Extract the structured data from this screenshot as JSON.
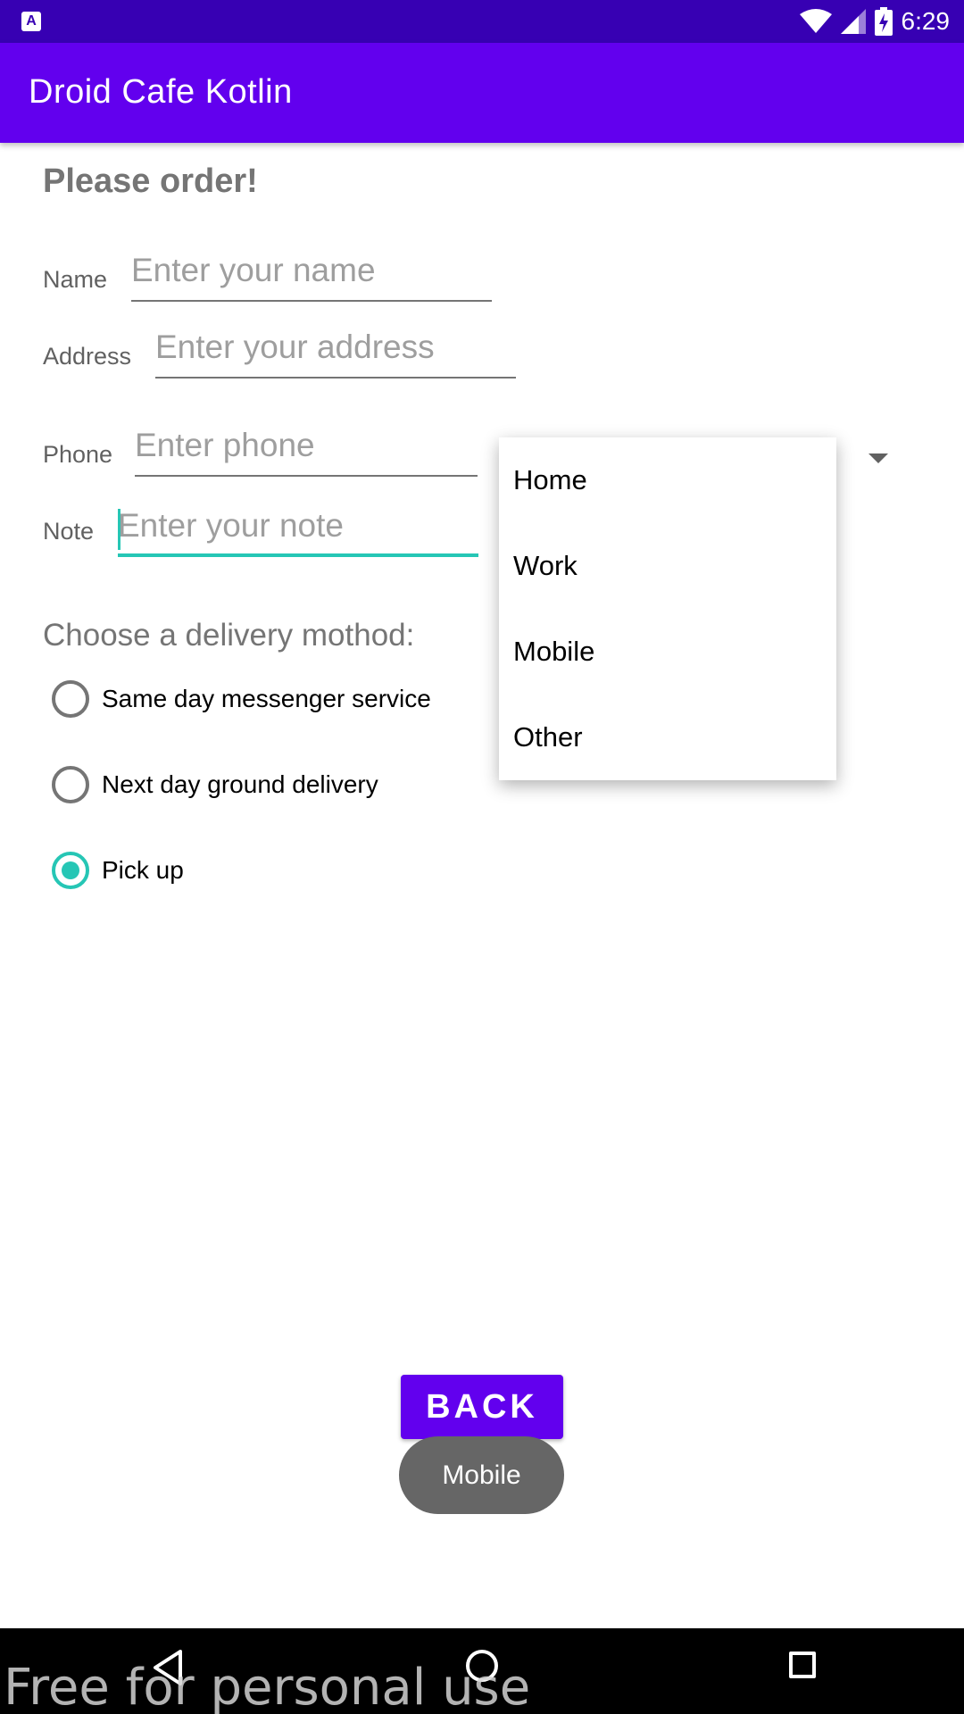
{
  "status_bar": {
    "time": "6:29",
    "left_icon_glyph": "A",
    "icons": [
      "wifi-icon",
      "signal-icon",
      "battery-charging-icon"
    ]
  },
  "app_bar": {
    "title": "Droid Cafe Kotlin"
  },
  "form": {
    "heading": "Please order!",
    "name": {
      "label": "Name",
      "placeholder": "Enter your name",
      "value": ""
    },
    "address": {
      "label": "Address",
      "placeholder": "Enter your address",
      "value": ""
    },
    "phone": {
      "label": "Phone",
      "placeholder": "Enter phone",
      "value": ""
    },
    "note": {
      "label": "Note",
      "placeholder": "Enter your note",
      "value": ""
    }
  },
  "phone_type_dropdown": {
    "options": [
      "Home",
      "Work",
      "Mobile",
      "Other"
    ]
  },
  "delivery": {
    "title": "Choose a delivery mothod:",
    "options": [
      {
        "label": "Same day messenger service",
        "checked": false
      },
      {
        "label": "Next day ground delivery",
        "checked": false
      },
      {
        "label": "Pick up",
        "checked": true
      }
    ]
  },
  "back_button": {
    "label": "BACK"
  },
  "toast": {
    "text": "Mobile"
  },
  "watermark": {
    "text": "Free for personal use"
  },
  "colors": {
    "status_bar": "#3700b3",
    "primary": "#6200ee",
    "accent": "#26c6b5",
    "toast": "#666666"
  }
}
